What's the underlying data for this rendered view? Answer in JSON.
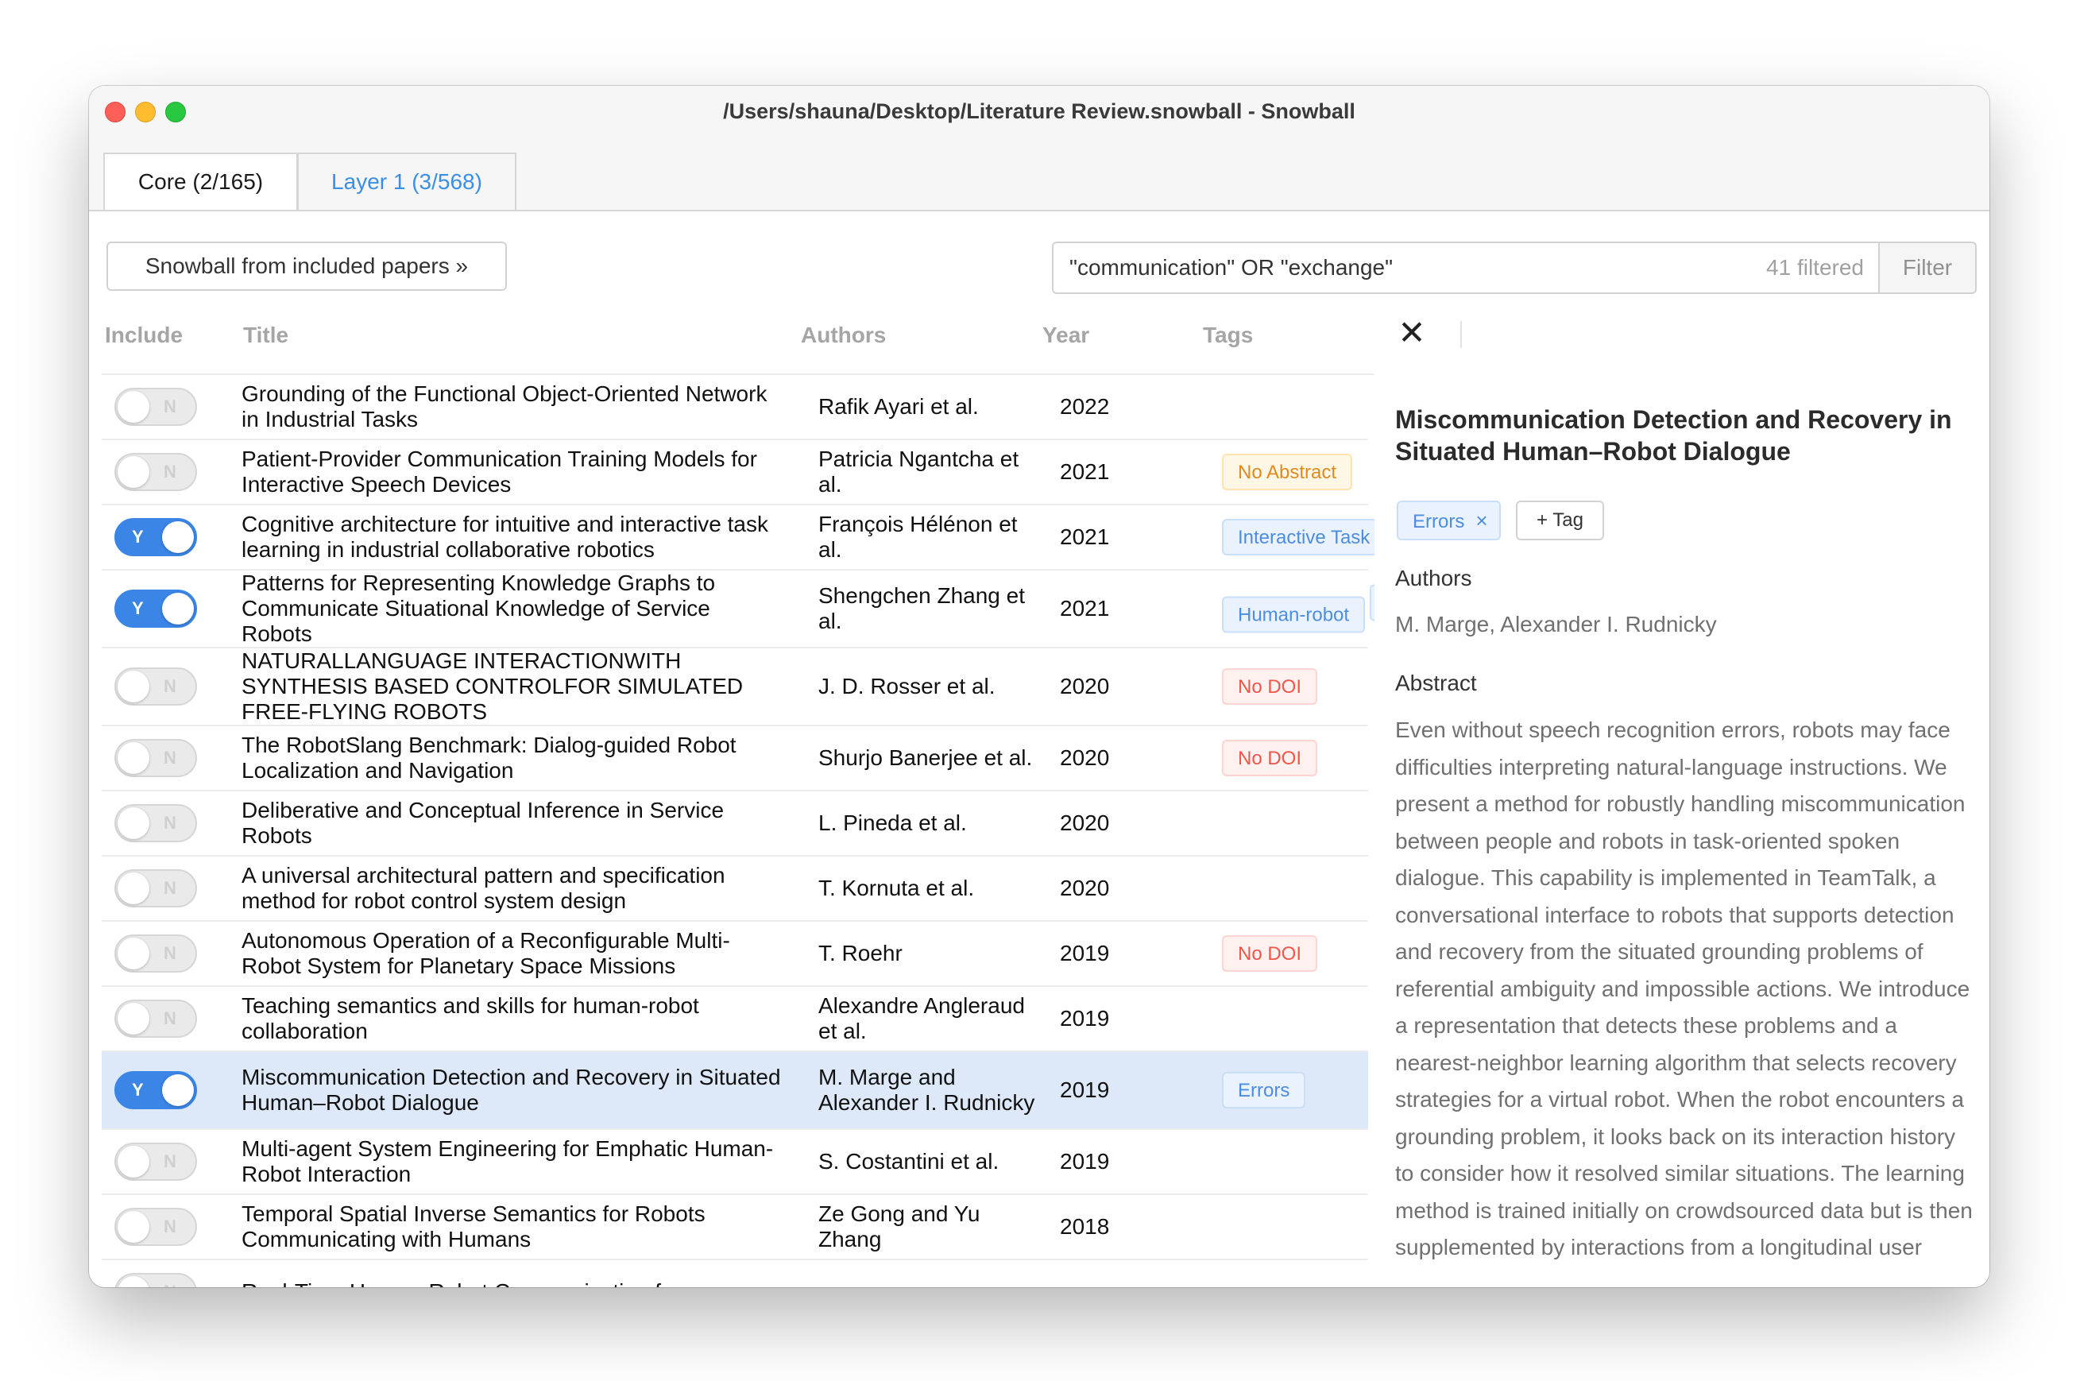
{
  "window": {
    "title": "/Users/shauna/Desktop/Literature Review.snowball - Snowball"
  },
  "tabs": [
    {
      "label": "Core (2/165)"
    },
    {
      "label": "Layer 1 (3/568)"
    }
  ],
  "toolbar": {
    "snowball_label": "Snowball from included papers »",
    "search_value": "\"communication\" OR \"exchange\"",
    "filtered_count": "41 filtered",
    "filter_label": "Filter"
  },
  "table": {
    "headers": {
      "include": "Include",
      "title": "Title",
      "authors": "Authors",
      "year": "Year",
      "tags": "Tags"
    },
    "rows": [
      {
        "include": false,
        "toggle": "N",
        "title": "Grounding of the Functional Object-Oriented Network in Industrial Tasks",
        "authors": "Rafik Ayari et al.",
        "year": "2022",
        "tags": []
      },
      {
        "include": false,
        "toggle": "N",
        "title": "Patient-Provider Communication Training Models for Interactive Speech Devices",
        "authors": "Patricia Ngantcha et al.",
        "year": "2021",
        "tags": [
          {
            "label": "No Abstract",
            "kind": "warn"
          }
        ]
      },
      {
        "include": true,
        "toggle": "Y",
        "title": "Cognitive architecture for intuitive and interactive task learning in industrial collaborative robotics",
        "authors": "François Hélénon et al.",
        "year": "2021",
        "tags": [
          {
            "label": "Interactive Task",
            "kind": "info"
          }
        ]
      },
      {
        "include": true,
        "toggle": "Y",
        "title": "Patterns for Representing Knowledge Graphs to Communicate Situational Knowledge of Service Robots",
        "authors": "Shengchen Zhang et al.",
        "year": "2021",
        "tags": [
          {
            "label": "Human-robot",
            "kind": "info"
          },
          {
            "label": "",
            "kind": "stub"
          }
        ]
      },
      {
        "include": false,
        "toggle": "N",
        "title": "NATURALLANGUAGE INTERACTIONWITH SYNTHESIS BASED CONTROLFOR SIMULATED FREE-FLYING ROBOTS",
        "authors": "J. D. Rosser et al.",
        "year": "2020",
        "tags": [
          {
            "label": "No DOI",
            "kind": "err"
          }
        ]
      },
      {
        "include": false,
        "toggle": "N",
        "title": "The RobotSlang Benchmark: Dialog-guided Robot Localization and Navigation",
        "authors": "Shurjo Banerjee et al.",
        "year": "2020",
        "tags": [
          {
            "label": "No DOI",
            "kind": "err"
          }
        ]
      },
      {
        "include": false,
        "toggle": "N",
        "title": "Deliberative and Conceptual Inference in Service Robots",
        "authors": "L. Pineda et al.",
        "year": "2020",
        "tags": []
      },
      {
        "include": false,
        "toggle": "N",
        "title": "A universal architectural pattern and specification method for robot control system design",
        "authors": "T. Kornuta et al.",
        "year": "2020",
        "tags": []
      },
      {
        "include": false,
        "toggle": "N",
        "title": "Autonomous Operation of a Reconfigurable Multi-Robot System for Planetary Space Missions",
        "authors": "T. Roehr",
        "year": "2019",
        "tags": [
          {
            "label": "No DOI",
            "kind": "err"
          }
        ]
      },
      {
        "include": false,
        "toggle": "N",
        "title": "Teaching semantics and skills for human-robot collaboration",
        "authors": "Alexandre Angleraud et al.",
        "year": "2019",
        "tags": []
      },
      {
        "include": true,
        "toggle": "Y",
        "selected": true,
        "title": "Miscommunication Detection and Recovery in Situated Human–Robot Dialogue",
        "authors": "M. Marge and Alexander I. Rudnicky",
        "year": "2019",
        "tags": [
          {
            "label": "Errors",
            "kind": "info"
          }
        ]
      },
      {
        "include": false,
        "toggle": "N",
        "title": "Multi-agent System Engineering for Emphatic Human-Robot Interaction",
        "authors": "S. Costantini et al.",
        "year": "2019",
        "tags": []
      },
      {
        "include": false,
        "toggle": "N",
        "title": "Temporal Spatial Inverse Semantics for Robots Communicating with Humans",
        "authors": "Ze Gong and Yu Zhang",
        "year": "2018",
        "tags": []
      },
      {
        "include": false,
        "toggle": "N",
        "title": "Real-Time Human-Robot Communication for",
        "authors": "",
        "year": "",
        "tags": []
      }
    ]
  },
  "detail": {
    "close_icon": "close-icon",
    "title": "Miscommunication Detection and Recovery in Situated Human–Robot Dialogue",
    "tag": "Errors",
    "tag_remove": "×",
    "add_tag": "+ Tag",
    "authors_label": "Authors",
    "authors": "M. Marge, Alexander I. Rudnicky",
    "abstract_label": "Abstract",
    "abstract": "Even without speech recognition errors, robots may face difficulties interpreting natural-language instructions. We present a method for robustly handling miscommunication between people and robots in task-oriented spoken dialogue. This capability is implemented in TeamTalk, a conversational interface to robots that supports detection and recovery from the situated grounding problems of referential ambiguity and impossible actions. We introduce a representation that detects these problems and a nearest-neighbor learning algorithm that selects recovery strategies for a virtual robot. When the robot encounters a grounding problem, it looks back on its interaction history to consider how it resolved similar situations. The learning method is trained initially on crowdsourced data but is then supplemented by interactions from a longitudinal user"
  },
  "colors": {
    "accent": "#3a85e6",
    "selected_row": "#dde9f8",
    "warn": "#e08a1e",
    "error": "#f0564a",
    "info": "#4d8ddf"
  }
}
